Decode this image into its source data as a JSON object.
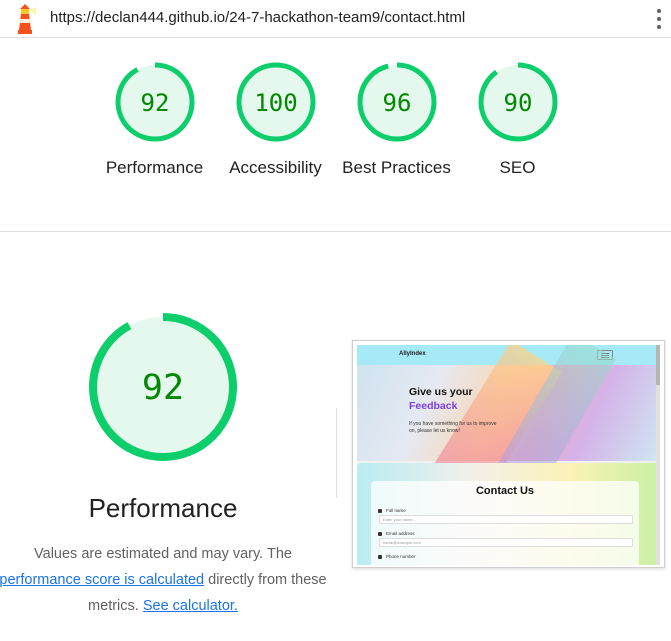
{
  "header": {
    "url": "https://declan444.github.io/24-7-hackathon-team9/contact.html",
    "logo_icon": "lighthouse-icon",
    "menu_icon": "more-vert-icon"
  },
  "colors": {
    "pass_green": "#0cce6b",
    "pass_fill": "#e5f8ed",
    "pass_text": "#008800"
  },
  "summary": [
    {
      "score": 92,
      "label": "Performance"
    },
    {
      "score": 100,
      "label": "Accessibility"
    },
    {
      "score": 96,
      "label": "Best Practices"
    },
    {
      "score": 90,
      "label": "SEO"
    }
  ],
  "category": {
    "score": 92,
    "title": "Performance",
    "desc_1": "Values are estimated and may vary. The",
    "desc_link_1": "performance score is calculated",
    "desc_2": "directly from these metrics.",
    "desc_link_2": "See calculator."
  },
  "screenshot": {
    "brand": "AllyIndex",
    "heading_1": "Give us your",
    "heading_2": "Feedback",
    "hero_text": "If you have something for us to improve on, please let us know!",
    "form_title": "Contact Us",
    "field_1_label": "Full name",
    "field_1_placeholder": "Enter your name...",
    "field_2_label": "Email address",
    "field_2_placeholder": "name@example.com",
    "field_3_label": "Phone number"
  }
}
